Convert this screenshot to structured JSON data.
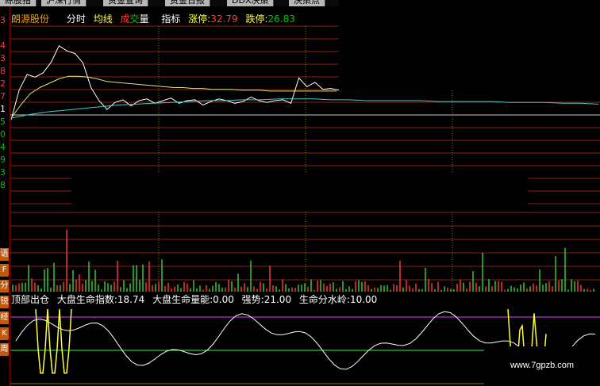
{
  "tabs": [
    "綜股指",
    "沪深行情",
    "资金查询",
    "资金日报",
    "DDX决策",
    "决策点"
  ],
  "stock_name": "朗源股份",
  "header_items": {
    "fenshi": "分时",
    "junxian": "均线",
    "cheng": "成",
    "jiao": "交",
    "liang": "量",
    "zhibiao": "指标",
    "zhangting_label": "涨停:",
    "zhangting_value": "32.79",
    "dieting_label": "跌停:",
    "dieting_value": "26.83"
  },
  "y_axis_labels": [
    {
      "text": "3",
      "tone": "red"
    },
    {
      "text": "4",
      "tone": "red"
    },
    {
      "text": "3",
      "tone": "red"
    },
    {
      "text": "8",
      "tone": "red"
    },
    {
      "text": "2",
      "tone": "red"
    },
    {
      "text": "7",
      "tone": "red"
    },
    {
      "text": "1",
      "tone": "mid"
    },
    {
      "text": "5",
      "tone": "green"
    },
    {
      "text": "0",
      "tone": "green"
    },
    {
      "text": "4",
      "tone": "green"
    },
    {
      "text": "9",
      "tone": "green"
    },
    {
      "text": "3",
      "tone": "green"
    },
    {
      "text": "8",
      "tone": "green"
    }
  ],
  "side_buttons": [
    "语",
    "F",
    "分",
    "锐",
    "经",
    "K",
    "周"
  ],
  "indicator": {
    "name": "顶部出仓",
    "items": [
      {
        "label": "大盘生命指数:",
        "value": "18.74"
      },
      {
        "label": "大盘生命量能:",
        "value": "0.00"
      },
      {
        "label": "强势:",
        "value": "21.00"
      },
      {
        "label": "生命分水岭:",
        "value": "10.00"
      }
    ]
  },
  "watermark": "www.7gpzb.com",
  "colors": {
    "price_line": "#ffffff",
    "avg_line": "#e6e676",
    "long_avg_line": "#46c8c8",
    "grid": "#8c1e1e",
    "grid_v": "#8b7a00",
    "vol_up": "#ff3232",
    "vol_down": "#32c832",
    "indicator_yellow": "#ffff40",
    "indicator_green": "#32ff32",
    "indicator_magenta": "#e040ff"
  },
  "chart_data": {
    "type": "line",
    "series": [
      {
        "values": [
          0.08,
          0.42,
          0.6,
          0.57,
          0.62,
          0.74,
          0.93,
          0.87,
          0.84,
          0.73,
          0.45,
          0.3,
          0.2,
          0.28,
          0.31,
          0.24,
          0.3,
          0.32,
          0.27,
          0.3,
          0.33,
          0.27,
          0.3,
          0.31,
          0.25,
          0.29,
          0.32,
          0.3,
          0.27,
          0.29,
          0.34,
          0.3,
          0.28,
          0.3,
          0.31,
          0.27,
          0.56,
          0.46,
          0.51,
          0.43,
          0.44,
          0.42
        ]
      },
      {
        "values": [
          0.1,
          0.25,
          0.38,
          0.45,
          0.5,
          0.55,
          0.58,
          0.58,
          0.57,
          0.55,
          0.52,
          0.51,
          0.5,
          0.49,
          0.48,
          0.47,
          0.46,
          0.45,
          0.45,
          0.44,
          0.44,
          0.43,
          0.43,
          0.43,
          0.42,
          0.42,
          0.42,
          0.41,
          0.41,
          0.41,
          0.41,
          0.41,
          0.41,
          0.41,
          0.41
        ]
      },
      {
        "values": [
          0.1,
          0.14,
          0.17,
          0.19,
          0.21,
          0.23,
          0.25,
          0.26,
          0.27,
          0.28,
          0.29,
          0.3,
          0.3,
          0.31,
          0.31,
          0.32,
          0.32,
          0.32,
          0.31,
          0.31,
          0.3,
          0.3,
          0.3,
          0.3,
          0.29,
          0.29,
          0.29,
          0.29,
          0.28,
          0.28,
          0.28,
          0.27,
          0.27,
          0.26
        ]
      }
    ]
  }
}
